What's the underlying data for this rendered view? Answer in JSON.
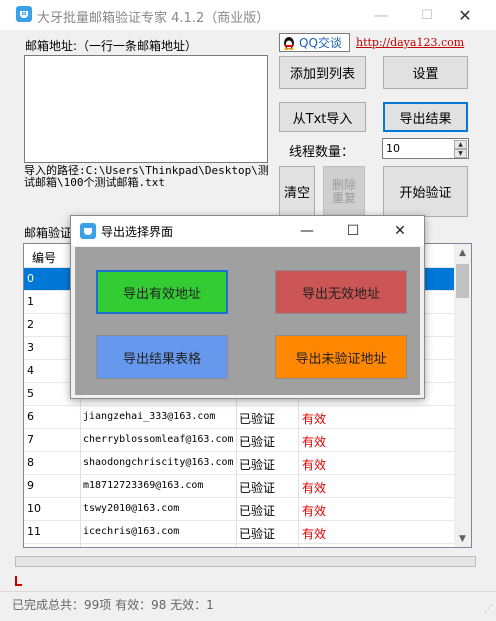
{
  "window": {
    "title": "大牙批量邮箱验证专家 4.1.2（商业版）",
    "minimize": "—",
    "maximize": "☐",
    "close": "✕"
  },
  "main": {
    "email_label": "邮箱地址:（一行一条邮箱地址）",
    "import_path": "导入的路径:C:\\Users\\Thinkpad\\Desktop\\测试邮箱\\100个测试邮箱.txt",
    "list_label": "邮箱验证"
  },
  "toolbar": {
    "qq_label": "QQ交谈",
    "link": "http://daya123.com",
    "add_to_list": "添加到列表",
    "settings": "设置",
    "import_txt": "从Txt导入",
    "export_results": "导出结果",
    "thread_label": "线程数量：",
    "thread_value": "10",
    "clear": "清空",
    "delete_duplicates": "删除重复",
    "start": "开始验证"
  },
  "table": {
    "header_no": "编号",
    "rows": [
      {
        "no": "0",
        "email": "",
        "status": "",
        "result": ""
      },
      {
        "no": "1",
        "email": "",
        "status": "",
        "result": ""
      },
      {
        "no": "2",
        "email": "",
        "status": "",
        "result": ""
      },
      {
        "no": "3",
        "email": "",
        "status": "",
        "result": ""
      },
      {
        "no": "4",
        "email": "",
        "status": "",
        "result": ""
      },
      {
        "no": "5",
        "email": "",
        "status": "",
        "result": ""
      },
      {
        "no": "6",
        "email": "jiangzehai_333@163.com",
        "status": "已验证",
        "result": "有效"
      },
      {
        "no": "7",
        "email": "cherryblossomleaf@163.com",
        "status": "已验证",
        "result": "有效"
      },
      {
        "no": "8",
        "email": "shaodongchriscity@163.com",
        "status": "已验证",
        "result": "有效"
      },
      {
        "no": "9",
        "email": "m18712723369@163.com",
        "status": "已验证",
        "result": "有效"
      },
      {
        "no": "10",
        "email": "tswy2010@163.com",
        "status": "已验证",
        "result": "有效"
      },
      {
        "no": "11",
        "email": "icechris@163.com",
        "status": "已验证",
        "result": "有效"
      }
    ]
  },
  "status_bar": {
    "text": "已完成总共：99项 有效：98  无效：1"
  },
  "dialog": {
    "title": "导出选择界面",
    "export_valid": "导出有效地址",
    "export_invalid": "导出无效地址",
    "export_table": "导出结果表格",
    "export_unverified": "导出未验证地址",
    "colors": {
      "valid": "#33cc33",
      "invalid": "#cc5555",
      "table": "#6699ee",
      "unverified": "#ff8800"
    }
  }
}
